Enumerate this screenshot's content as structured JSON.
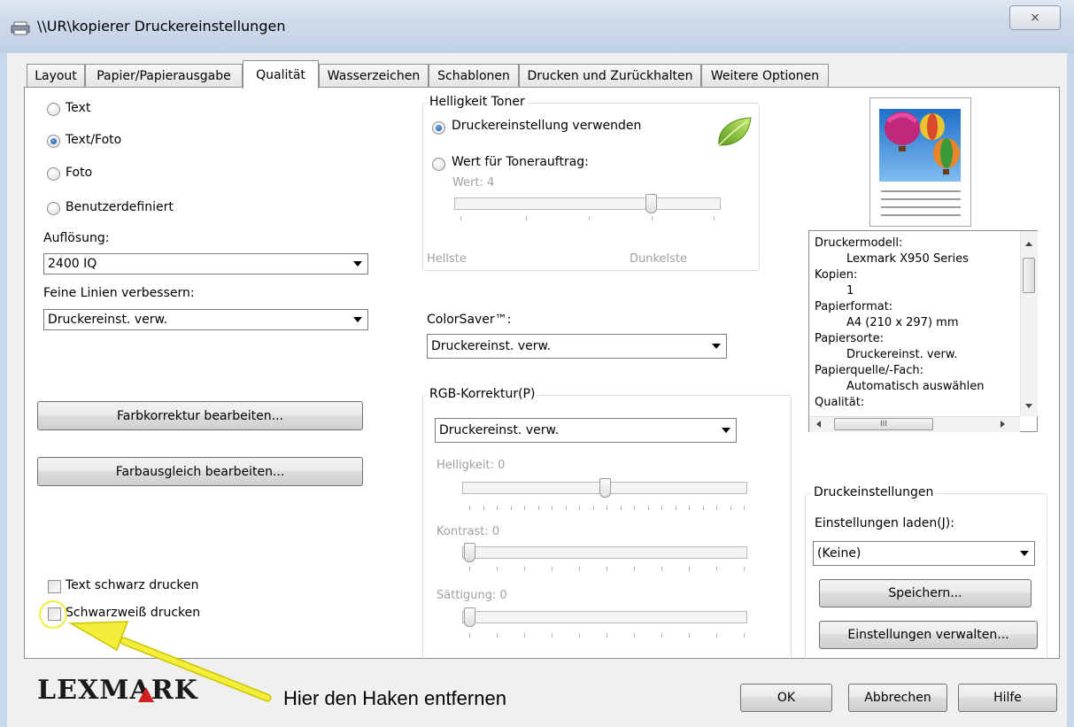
{
  "window": {
    "title": "\\\\UR\\kopierer Druckereinstellungen",
    "close_label": "⨯"
  },
  "tabs": [
    {
      "label": "Layout"
    },
    {
      "label": "Papier/Papierausgabe"
    },
    {
      "label": "Qualität"
    },
    {
      "label": "Wasserzeichen"
    },
    {
      "label": "Schablonen"
    },
    {
      "label": "Drucken und Zurückhalten"
    },
    {
      "label": "Weitere Optionen"
    }
  ],
  "active_tab": "Qualität",
  "quality_mode": {
    "options": [
      {
        "label": "Text",
        "selected": false
      },
      {
        "label": "Text/Foto",
        "selected": true
      },
      {
        "label": "Foto",
        "selected": false
      },
      {
        "label": "Benutzerdefiniert",
        "selected": false
      }
    ]
  },
  "resolution": {
    "label": "Auflösung:",
    "value": "2400 IQ"
  },
  "fine_lines": {
    "label": "Feine Linien verbessern:",
    "value": "Druckereinst. verw."
  },
  "buttons": {
    "color_correction": "Farbkorrektur bearbeiten...",
    "color_balance": "Farbausgleich bearbeiten..."
  },
  "checkboxes": {
    "print_text_black": {
      "label": "Text schwarz drucken",
      "checked": false
    },
    "print_bw": {
      "label": "Schwarzweiß drucken",
      "checked": false
    }
  },
  "toner": {
    "group_label": "Helligkeit Toner",
    "option_printer": {
      "label": "Druckereinstellung verwenden",
      "selected": true
    },
    "option_value": {
      "label": "Wert für Tonerauftrag:",
      "selected": false
    },
    "value_label": "Wert: 4",
    "value": 4,
    "min_label": "Hellste",
    "max_label": "Dunkelste"
  },
  "colorsaver": {
    "label": "ColorSaver™:",
    "value": "Druckereinst. verw."
  },
  "rgb": {
    "group_label": "RGB-Korrektur(P)",
    "value": "Druckereinst. verw.",
    "brightness_label": "Helligkeit: 0",
    "contrast_label": "Kontrast: 0",
    "saturation_label": "Sättigung: 0"
  },
  "summary": {
    "lines": [
      {
        "text": "Druckermodell:",
        "indent": false
      },
      {
        "text": "Lexmark X950 Series",
        "indent": true
      },
      {
        "text": "Kopien:",
        "indent": false
      },
      {
        "text": "1",
        "indent": true
      },
      {
        "text": "Papierformat:",
        "indent": false
      },
      {
        "text": "A4 (210 x 297) mm",
        "indent": true
      },
      {
        "text": "Papiersorte:",
        "indent": false
      },
      {
        "text": "Druckereinst. verw.",
        "indent": true
      },
      {
        "text": "Papierquelle/-Fach:",
        "indent": false
      },
      {
        "text": "Automatisch auswählen",
        "indent": true
      },
      {
        "text": "Qualität:",
        "indent": false
      }
    ],
    "hscroll_grip": "III"
  },
  "print_settings": {
    "group_label": "Druckeinstellungen",
    "load_label": "Einstellungen laden(J):",
    "load_value": "(Keine)",
    "save_button": "Speichern...",
    "manage_button": "Einstellungen verwalten..."
  },
  "footer": {
    "logo": "LEXMARK",
    "annotation": "Hier den Haken entfernen",
    "ok": "OK",
    "cancel": "Abbrechen",
    "help": "Hilfe"
  },
  "colors": {
    "annotation_arrow": "#f2ee3a",
    "logo": "#1a1a1a",
    "logo_accent": "#d02020"
  }
}
